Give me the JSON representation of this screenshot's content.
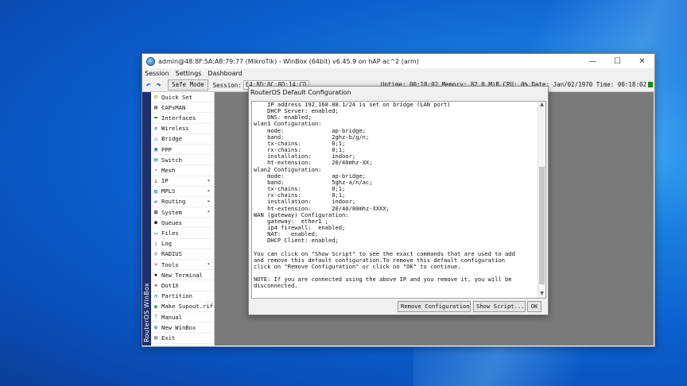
{
  "window": {
    "title": "admin@48:8F:5A:A8:79:77 (MikroTik) - WinBox (64bit) v6.45.9 on hAP ac^2 (arm)",
    "controls": [
      "—",
      "☐",
      "✕"
    ]
  },
  "menu": [
    "Session",
    "Settings",
    "Dashboard"
  ],
  "toolbar": {
    "safe_mode": "Safe Mode",
    "session_label": "Session:",
    "session_value": "E4:8D:8C:8D:14:CD",
    "status": "Uptime: 00:18:02 Memory: 82.0 MiB CPU: 0% Date: Jan/02/1970 Time: 00:18:02"
  },
  "brand_strip": "RouterOS WinBox",
  "sidebar": [
    {
      "label": "Quick Set",
      "icon": "quick-set-icon",
      "glyph": "⚙",
      "color": "#b8860b",
      "arrow": ""
    },
    {
      "label": "CAPsMAN",
      "icon": "capsman-icon",
      "glyph": "▦",
      "color": "#555",
      "arrow": ""
    },
    {
      "label": "Interfaces",
      "icon": "interfaces-icon",
      "glyph": "▬",
      "color": "#2f8a2f",
      "arrow": ""
    },
    {
      "label": "Wireless",
      "icon": "wireless-icon",
      "glyph": "≋",
      "color": "#1f6fbf",
      "arrow": ""
    },
    {
      "label": "Bridge",
      "icon": "bridge-icon",
      "glyph": "⌂",
      "color": "#2a6fbf",
      "arrow": ""
    },
    {
      "label": "PPP",
      "icon": "ppp-icon",
      "glyph": "▣",
      "color": "#2a6fbf",
      "arrow": ""
    },
    {
      "label": "Switch",
      "icon": "switch-icon",
      "glyph": "▤",
      "color": "#2a6fbf",
      "arrow": ""
    },
    {
      "label": "Mesh",
      "icon": "mesh-icon",
      "glyph": "✦",
      "color": "#3a7fcf",
      "arrow": ""
    },
    {
      "label": "IP",
      "icon": "ip-icon",
      "glyph": "ı",
      "color": "#333",
      "arrow": "▸"
    },
    {
      "label": "MPLS",
      "icon": "mpls-icon",
      "glyph": "▥",
      "color": "#2a6fbf",
      "arrow": "▸"
    },
    {
      "label": "Routing",
      "icon": "routing-icon",
      "glyph": "⇄",
      "color": "#2a6fbf",
      "arrow": "▸"
    },
    {
      "label": "System",
      "icon": "system-icon",
      "glyph": "▩",
      "color": "#555",
      "arrow": "▸"
    },
    {
      "label": "Queues",
      "icon": "queues-icon",
      "glyph": "●",
      "color": "#333",
      "arrow": ""
    },
    {
      "label": "Files",
      "icon": "files-icon",
      "glyph": "▭",
      "color": "#2a6fbf",
      "arrow": ""
    },
    {
      "label": "Log",
      "icon": "log-icon",
      "glyph": "▯",
      "color": "#777",
      "arrow": ""
    },
    {
      "label": "RADIUS",
      "icon": "radius-icon",
      "glyph": "☺",
      "color": "#555",
      "arrow": ""
    },
    {
      "label": "Tools",
      "icon": "tools-icon",
      "glyph": "✕",
      "color": "#c0392b",
      "arrow": "▸"
    },
    {
      "label": "New Terminal",
      "icon": "terminal-icon",
      "glyph": "▪",
      "color": "#111",
      "arrow": ""
    },
    {
      "label": "Dot1X",
      "icon": "dot1x-icon",
      "glyph": "✚",
      "color": "#c0392b",
      "arrow": ""
    },
    {
      "label": "Partition",
      "icon": "partition-icon",
      "glyph": "◔",
      "color": "#2a6fbf",
      "arrow": ""
    },
    {
      "label": "Make Supout.rif",
      "icon": "supout-icon",
      "glyph": "◉",
      "color": "#1d8a4a",
      "arrow": ""
    },
    {
      "label": "Manual",
      "icon": "manual-icon",
      "glyph": "?",
      "color": "#2a6fbf",
      "arrow": ""
    },
    {
      "label": "New WinBox",
      "icon": "new-winbox-icon",
      "glyph": "◍",
      "color": "#2a6fbf",
      "arrow": ""
    },
    {
      "label": "Exit",
      "icon": "exit-icon",
      "glyph": "▤",
      "color": "#555",
      "arrow": ""
    }
  ],
  "dialog": {
    "title": "RouterOS Default Configuration",
    "text": "    IP address 192.168.88.1/24 is set on bridge (LAN port)\n    DHCP Server: enabled;\n    DNS: enabled;\nwlan1 Configuration:\n    mode:              ap-bridge;\n    band:              2ghz-b/g/n;\n    tx-chains:         0;1;\n    rx-chains:         0;1;\n    installation:      indoor;\n    ht-extension:      20/40mhz-XX;\nwlan2 Configuration:\n    mode:              ap-bridge;\n    band:              5ghz-a/n/ac;\n    tx-chains:         0;1;\n    rx-chains:         0;1;\n    installation:      indoor;\n    ht-extension:      20/40/80mhz-XXXX;\nWAN (gateway) Configuration:\n    gateway:  ether1 ;\n    ip4 firewall:  enabled;\n    NAT:   enabled;\n    DHCP Client: enabled;\n\nYou can click on \"Show Script\" to see the exact commands that are used to add\nand remove this default configuration.To remove this default configuration\nclick on \"Remove Configuration\" or click on \"OK\" to continue.\n\nNOTE: If you are connected using the above IP and you remove it, you will be\ndisconnected.",
    "buttons": {
      "remove": "Remove Configuration",
      "show_script": "Show Script...",
      "ok": "OK"
    }
  }
}
